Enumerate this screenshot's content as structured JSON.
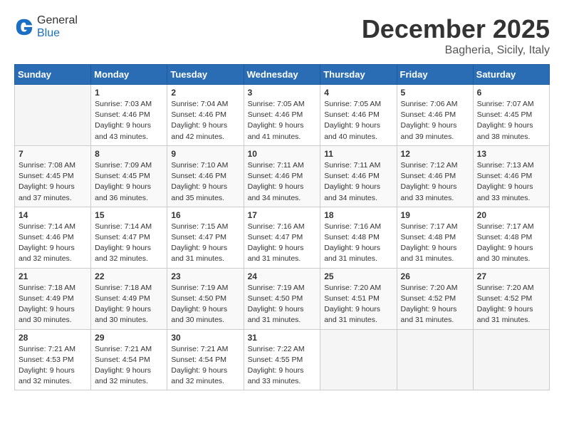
{
  "header": {
    "logo_line1": "General",
    "logo_line2": "Blue",
    "month": "December 2025",
    "location": "Bagheria, Sicily, Italy"
  },
  "weekdays": [
    "Sunday",
    "Monday",
    "Tuesday",
    "Wednesday",
    "Thursday",
    "Friday",
    "Saturday"
  ],
  "weeks": [
    [
      {
        "day": "",
        "sunrise": "",
        "sunset": "",
        "daylight": ""
      },
      {
        "day": "1",
        "sunrise": "7:03 AM",
        "sunset": "4:46 PM",
        "daylight": "9 hours and 43 minutes."
      },
      {
        "day": "2",
        "sunrise": "7:04 AM",
        "sunset": "4:46 PM",
        "daylight": "9 hours and 42 minutes."
      },
      {
        "day": "3",
        "sunrise": "7:05 AM",
        "sunset": "4:46 PM",
        "daylight": "9 hours and 41 minutes."
      },
      {
        "day": "4",
        "sunrise": "7:05 AM",
        "sunset": "4:46 PM",
        "daylight": "9 hours and 40 minutes."
      },
      {
        "day": "5",
        "sunrise": "7:06 AM",
        "sunset": "4:46 PM",
        "daylight": "9 hours and 39 minutes."
      },
      {
        "day": "6",
        "sunrise": "7:07 AM",
        "sunset": "4:45 PM",
        "daylight": "9 hours and 38 minutes."
      }
    ],
    [
      {
        "day": "7",
        "sunrise": "7:08 AM",
        "sunset": "4:45 PM",
        "daylight": "9 hours and 37 minutes."
      },
      {
        "day": "8",
        "sunrise": "7:09 AM",
        "sunset": "4:45 PM",
        "daylight": "9 hours and 36 minutes."
      },
      {
        "day": "9",
        "sunrise": "7:10 AM",
        "sunset": "4:46 PM",
        "daylight": "9 hours and 35 minutes."
      },
      {
        "day": "10",
        "sunrise": "7:11 AM",
        "sunset": "4:46 PM",
        "daylight": "9 hours and 34 minutes."
      },
      {
        "day": "11",
        "sunrise": "7:11 AM",
        "sunset": "4:46 PM",
        "daylight": "9 hours and 34 minutes."
      },
      {
        "day": "12",
        "sunrise": "7:12 AM",
        "sunset": "4:46 PM",
        "daylight": "9 hours and 33 minutes."
      },
      {
        "day": "13",
        "sunrise": "7:13 AM",
        "sunset": "4:46 PM",
        "daylight": "9 hours and 33 minutes."
      }
    ],
    [
      {
        "day": "14",
        "sunrise": "7:14 AM",
        "sunset": "4:46 PM",
        "daylight": "9 hours and 32 minutes."
      },
      {
        "day": "15",
        "sunrise": "7:14 AM",
        "sunset": "4:47 PM",
        "daylight": "9 hours and 32 minutes."
      },
      {
        "day": "16",
        "sunrise": "7:15 AM",
        "sunset": "4:47 PM",
        "daylight": "9 hours and 31 minutes."
      },
      {
        "day": "17",
        "sunrise": "7:16 AM",
        "sunset": "4:47 PM",
        "daylight": "9 hours and 31 minutes."
      },
      {
        "day": "18",
        "sunrise": "7:16 AM",
        "sunset": "4:48 PM",
        "daylight": "9 hours and 31 minutes."
      },
      {
        "day": "19",
        "sunrise": "7:17 AM",
        "sunset": "4:48 PM",
        "daylight": "9 hours and 31 minutes."
      },
      {
        "day": "20",
        "sunrise": "7:17 AM",
        "sunset": "4:48 PM",
        "daylight": "9 hours and 30 minutes."
      }
    ],
    [
      {
        "day": "21",
        "sunrise": "7:18 AM",
        "sunset": "4:49 PM",
        "daylight": "9 hours and 30 minutes."
      },
      {
        "day": "22",
        "sunrise": "7:18 AM",
        "sunset": "4:49 PM",
        "daylight": "9 hours and 30 minutes."
      },
      {
        "day": "23",
        "sunrise": "7:19 AM",
        "sunset": "4:50 PM",
        "daylight": "9 hours and 30 minutes."
      },
      {
        "day": "24",
        "sunrise": "7:19 AM",
        "sunset": "4:50 PM",
        "daylight": "9 hours and 31 minutes."
      },
      {
        "day": "25",
        "sunrise": "7:20 AM",
        "sunset": "4:51 PM",
        "daylight": "9 hours and 31 minutes."
      },
      {
        "day": "26",
        "sunrise": "7:20 AM",
        "sunset": "4:52 PM",
        "daylight": "9 hours and 31 minutes."
      },
      {
        "day": "27",
        "sunrise": "7:20 AM",
        "sunset": "4:52 PM",
        "daylight": "9 hours and 31 minutes."
      }
    ],
    [
      {
        "day": "28",
        "sunrise": "7:21 AM",
        "sunset": "4:53 PM",
        "daylight": "9 hours and 32 minutes."
      },
      {
        "day": "29",
        "sunrise": "7:21 AM",
        "sunset": "4:54 PM",
        "daylight": "9 hours and 32 minutes."
      },
      {
        "day": "30",
        "sunrise": "7:21 AM",
        "sunset": "4:54 PM",
        "daylight": "9 hours and 32 minutes."
      },
      {
        "day": "31",
        "sunrise": "7:22 AM",
        "sunset": "4:55 PM",
        "daylight": "9 hours and 33 minutes."
      },
      {
        "day": "",
        "sunrise": "",
        "sunset": "",
        "daylight": ""
      },
      {
        "day": "",
        "sunrise": "",
        "sunset": "",
        "daylight": ""
      },
      {
        "day": "",
        "sunrise": "",
        "sunset": "",
        "daylight": ""
      }
    ]
  ],
  "labels": {
    "sunrise_prefix": "Sunrise: ",
    "sunset_prefix": "Sunset: ",
    "daylight_prefix": "Daylight: "
  }
}
